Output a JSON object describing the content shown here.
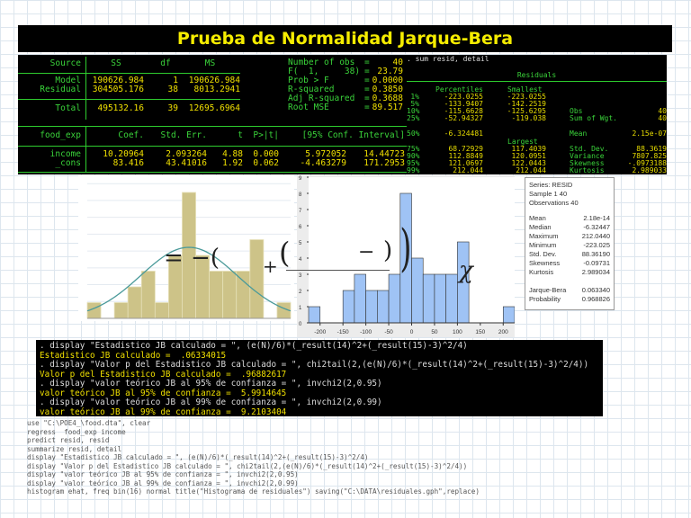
{
  "title": "Prueba de Normalidad Jarque-Bera",
  "regression": {
    "anova_header": [
      "Source",
      "SS",
      "df",
      "MS"
    ],
    "anova_rows": [
      [
        "Model",
        "190626.984",
        "1",
        "190626.984"
      ],
      [
        "Residual",
        "304505.176",
        "38",
        "8013.2941"
      ],
      [
        "Total",
        "495132.16",
        "39",
        "12695.6964"
      ]
    ],
    "fit_stats": [
      [
        "Number of obs",
        "=",
        "40"
      ],
      [
        "F(  1,     38)",
        "=",
        "23.79"
      ],
      [
        "Prob > F",
        "=",
        "0.0000"
      ],
      [
        "R-squared",
        "=",
        "0.3850"
      ],
      [
        "Adj R-squared",
        "=",
        "0.3688"
      ],
      [
        "Root MSE",
        "=",
        "89.517"
      ]
    ],
    "coef_header": [
      "food_exp",
      "Coef.",
      "Std. Err.",
      "t",
      "P>|t|",
      "[95% Conf. Interval]"
    ],
    "coef_rows": [
      [
        "income",
        "10.20964",
        "2.093264",
        "4.88",
        "0.000",
        "5.972052",
        "14.44723"
      ],
      [
        "_cons",
        "83.416",
        "43.41016",
        "1.92",
        "0.062",
        "-4.463279",
        "171.2953"
      ]
    ]
  },
  "summary": {
    "command": ". sum resid, detail",
    "heading": "Residuals",
    "col_percentiles": "Percentiles",
    "col_smallest": "Smallest",
    "col_largest": "Largest",
    "rows": [
      [
        "1%",
        "-223.0255",
        "-223.0255",
        "",
        ""
      ],
      [
        "5%",
        "-133.9407",
        "-142.2519",
        "",
        ""
      ],
      [
        "10%",
        "-115.6628",
        "-125.6295",
        "Obs",
        "40"
      ],
      [
        "25%",
        "-52.94327",
        "-119.038",
        "Sum of Wgt.",
        "40"
      ],
      [
        "50%",
        "-6.324481",
        "",
        "Mean",
        "2.15e-07"
      ],
      [
        "75%",
        "68.72929",
        "117.4039",
        "Std. Dev.",
        "88.3619"
      ],
      [
        "90%",
        "112.8849",
        "120.0951",
        "Variance",
        "7807.825"
      ],
      [
        "95%",
        "121.0697",
        "122.0443",
        "Skewness",
        "-.0973188"
      ],
      [
        "99%",
        "212.044",
        "212.044",
        "Kurtosis",
        "2.989033"
      ]
    ]
  },
  "formula_overlay": {
    "eq": "= −(",
    "plus": "+",
    "lparen": "(",
    "minus": "−",
    "rparen": ")",
    "bigparen": ")",
    "chi": "χ"
  },
  "chart_data": [
    {
      "type": "bar",
      "title": "",
      "bins_start": -187.5,
      "bin_width": 25,
      "values": [
        1,
        0,
        1,
        2,
        3,
        1,
        4,
        8,
        4,
        3,
        3,
        3,
        5,
        0,
        1
      ],
      "normal_overlay": {
        "mean": 0,
        "sd": 88.36,
        "n": 40
      },
      "ylim": [
        0,
        9
      ]
    },
    {
      "type": "bar",
      "title": "",
      "bins_start": -225,
      "bin_width": 25,
      "values": [
        1,
        0,
        0,
        2,
        3,
        2,
        2,
        3,
        8,
        4,
        3,
        3,
        3,
        5,
        0,
        0,
        0,
        1
      ],
      "xticks": [
        -200,
        -150,
        -100,
        -50,
        0,
        50,
        100,
        150,
        200
      ],
      "yticks": [
        0,
        1,
        2,
        3,
        4,
        5,
        6,
        7,
        8,
        9
      ],
      "ylim": [
        0,
        9
      ],
      "xlim": [
        -225,
        225
      ]
    }
  ],
  "stats_box": {
    "series": "Series: RESID",
    "sample": "Sample 1 40",
    "observations": "Observations 40",
    "rows": [
      [
        "Mean",
        "2.18e-14"
      ],
      [
        "Median",
        "-6.32447"
      ],
      [
        "Maximum",
        "212.0440"
      ],
      [
        "Minimum",
        "-223.025"
      ],
      [
        "Std. Dev.",
        "88.36190"
      ],
      [
        "Skewness",
        "-0.09731"
      ],
      [
        "Kurtosis",
        "2.989034"
      ]
    ],
    "jb": [
      [
        "Jarque-Bera",
        "0.063340"
      ],
      [
        "Probability",
        "0.968826"
      ]
    ]
  },
  "display_lines": [
    {
      "kind": "c",
      "text": ". display \"Estadistico JB calculado = \", (e(N)/6)*(_result(14)^2+(_result(15)-3)^2/4)"
    },
    {
      "kind": "r",
      "text": "Estadistico JB calculado =  .06334015"
    },
    {
      "kind": "c",
      "text": ". display \"Valor p del Estadistico JB calculado = \", chi2tail(2,(e(N)/6)*(_result(14)^2+(_result(15)-3)^2/4))"
    },
    {
      "kind": "r",
      "text": "Valor p del Estadistico JB calculado =  .96882617"
    },
    {
      "kind": "c",
      "text": ". display \"valor teórico JB al 95% de confianza = \", invchi2(2,0.95)"
    },
    {
      "kind": "r",
      "text": "valor teórico JB al 95% de confianza =  5.9914645"
    },
    {
      "kind": "c",
      "text": ". display \"valor teórico JB al 99% de confianza = \", invchi2(2,0.99)"
    },
    {
      "kind": "r",
      "text": "valor teórico JB al 99% de confianza =  9.2103404"
    }
  ],
  "code_lines": [
    "use \"C:\\POE4_\\food.dta\", clear",
    "regress  food_exp income",
    "predict resid, resid",
    "summarize resid, detail",
    "display \"Estadistico JB calculado = \", (e(N)/6)*(_result(14)^2+(_result(15)-3)^2/4)",
    "display \"Valor p del Estadistico JB calculado = \", chi2tail(2,(e(N)/6)*(_result(14)^2+(_result(15)-3)^2/4))",
    "display \"valor teórico JB al 95% de confianza = \", invchi2(2,0.95)",
    "display \"valor teórico JB al 99% de confianza = \", invchi2(2,0.99)",
    "histogram ehat, freq bin(16) normal title(\"Histograma de residuales\") saving(\"C:\\DATA\\residuales.gph\",replace)"
  ],
  "colors": {
    "stata_green": "#3ad33a",
    "stata_yellow": "#f0e000",
    "hist1": "#cdc388",
    "hist2": "#9fc3f5",
    "curve": "#4a9a9a"
  }
}
